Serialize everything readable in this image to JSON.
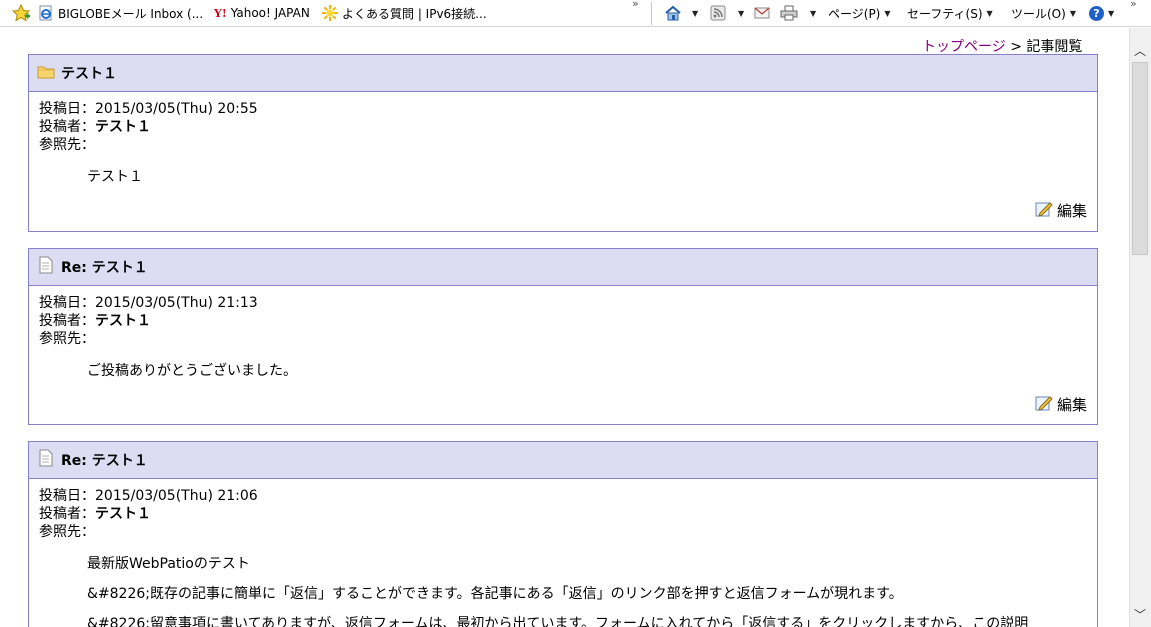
{
  "favorites": {
    "items": [
      {
        "label": "BIGLOBEメール Inbox (..."
      },
      {
        "label": "Yahoo! JAPAN",
        "icon_text": "Y!"
      },
      {
        "label": "よくある質問 | IPv6接続..."
      }
    ],
    "overflow": "»"
  },
  "command_bar": {
    "page_label": "ページ(P)",
    "safety_label": "セーフティ(S)",
    "tools_label": "ツール(O)",
    "help_icon_text": "?",
    "overflow": "»"
  },
  "breadcrumb": {
    "top_link": "トップページ",
    "separator": ">",
    "current": "記事閲覧"
  },
  "posts": [
    {
      "title": "テスト１",
      "date_label": "投稿日：",
      "date": "2015/03/05(Thu) 20:55",
      "author_label": "投稿者：",
      "author": "テスト１",
      "ref_label": "参照先：",
      "content": [
        "テスト１"
      ],
      "edit_label": "編集"
    },
    {
      "title": "Re: テスト１",
      "date_label": "投稿日：",
      "date": "2015/03/05(Thu) 21:13",
      "author_label": "投稿者：",
      "author": "テスト１",
      "ref_label": "参照先：",
      "content": [
        "ご投稿ありがとうございました。"
      ],
      "edit_label": "編集"
    },
    {
      "title": "Re: テスト１",
      "date_label": "投稿日：",
      "date": "2015/03/05(Thu) 21:06",
      "author_label": "投稿者：",
      "author": "テスト１",
      "ref_label": "参照先：",
      "content": [
        "最新版WebPatioのテスト",
        "&#8226;既存の記事に簡単に「返信」することができます。各記事にある「返信」のリンク部を押すと返信フォームが現れます。",
        "&#8226;留意事項に書いてありますが、返信フォームは、最初から出ています。フォームに入れてから「返信する」をクリックしますから、この説明"
      ]
    }
  ]
}
